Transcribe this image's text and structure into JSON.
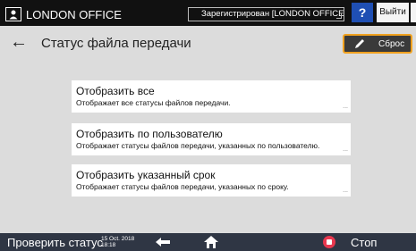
{
  "topbar": {
    "office_name": "LONDON OFFICE",
    "login_status": "Зарегистрирован [LONDON OFFICE]",
    "help_label": "?",
    "logout_label": "Выйти"
  },
  "header": {
    "title": "Статус файла передачи",
    "reset_label": "Сброс"
  },
  "options": [
    {
      "title": "Отобразить все",
      "description": "Отображает все статусы файлов передачи.",
      "more": "..."
    },
    {
      "title": "Отобразить по пользователю",
      "description": "Отображает статусы файлов передачи, указанных по пользователю.",
      "more": "..."
    },
    {
      "title": "Отобразить указанный срок",
      "description": "Отображает статусы файлов передачи, указанных по сроку.",
      "more": "..."
    }
  ],
  "bottombar": {
    "status_check": "Проверить статус",
    "date": "15 Oct. 2018",
    "time": "18:18",
    "stop_label": "Стоп"
  },
  "colors": {
    "accent_orange": "#f0a11f",
    "help_blue": "#1f4fb3",
    "stop_red": "#e8384f",
    "bottom_bar": "#2f3644"
  }
}
